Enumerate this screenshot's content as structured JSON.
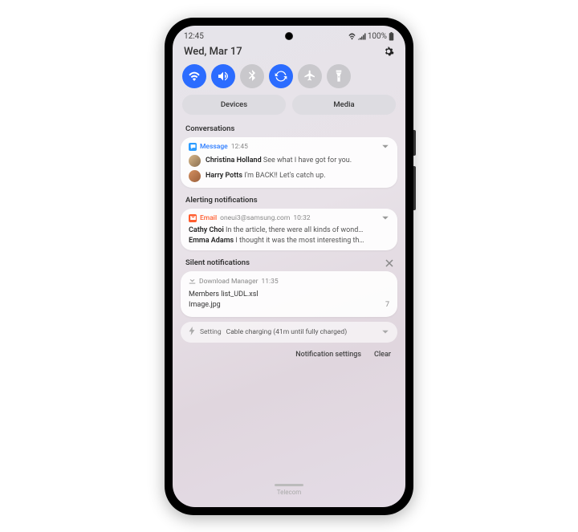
{
  "status": {
    "time": "12:45",
    "battery": "100%"
  },
  "header": {
    "date": "Wed, Mar 17"
  },
  "quick": {
    "devices": "Devices",
    "media": "Media"
  },
  "sections": {
    "conversations": "Conversations",
    "alerting": "Alerting notifications",
    "silent": "Silent notifications"
  },
  "msg": {
    "app": "Message",
    "time": "12:45",
    "items": [
      {
        "name": "Christina Holland",
        "body": "See what I have got for you."
      },
      {
        "name": "Harry Potts",
        "body": "I'm BACK!! Let's catch up."
      }
    ]
  },
  "email": {
    "app": "Email",
    "addr": "oneui3@samsung.com",
    "time": "10:32",
    "items": [
      {
        "name": "Cathy Choi",
        "body": "In the article, there were all kinds of wond…"
      },
      {
        "name": "Emma Adams",
        "body": "I thought it was the most interesting th…"
      }
    ]
  },
  "dl": {
    "app": "Download Manager",
    "time": "11:35",
    "files": [
      "Members list_UDL.xsl",
      "Image.jpg"
    ],
    "count": "7"
  },
  "setting": {
    "app": "Setting",
    "text": "Cable charging (41m until fully charged)"
  },
  "footer": {
    "settings": "Notification settings",
    "clear": "Clear"
  },
  "carrier": "Telecom"
}
